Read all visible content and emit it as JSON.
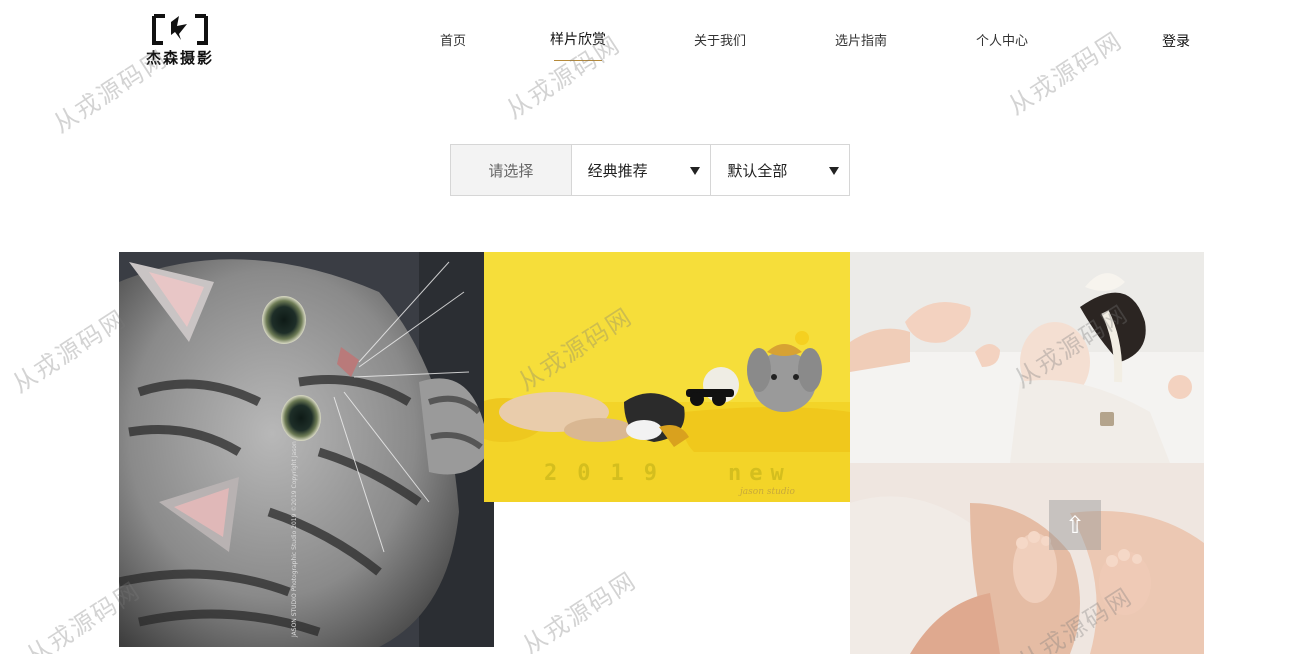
{
  "brand": {
    "name": "杰森摄影"
  },
  "nav": {
    "items": [
      {
        "label": "首页"
      },
      {
        "label": "样片欣赏"
      },
      {
        "label": "关于我们"
      },
      {
        "label": "选片指南"
      },
      {
        "label": "个人中心"
      }
    ],
    "active_item": "样片欣赏",
    "login_label": "登录"
  },
  "filter": {
    "label": "请选择",
    "category_value": "经典推荐",
    "scope_value": "默认全部"
  },
  "gallery": {
    "photos": [
      {
        "subject": "cat",
        "caption": "JASON STUDIO Photographic Studio 2019 ©2019 Copyright Jason"
      },
      {
        "subject": "dogs",
        "year_text": "2019",
        "new_text": "new",
        "studio_text": "jason studio"
      },
      {
        "subject": "baby-sleeping"
      },
      {
        "subject": "baby-feet"
      }
    ]
  },
  "back_to_top": {
    "label": "▲",
    "icon": "arrow-up-icon"
  },
  "watermark": {
    "text": "从戎源码网"
  },
  "colors": {
    "accent": "#b58a3a",
    "filter_bg": "#f3f3f3",
    "border": "#d6d6d6"
  }
}
